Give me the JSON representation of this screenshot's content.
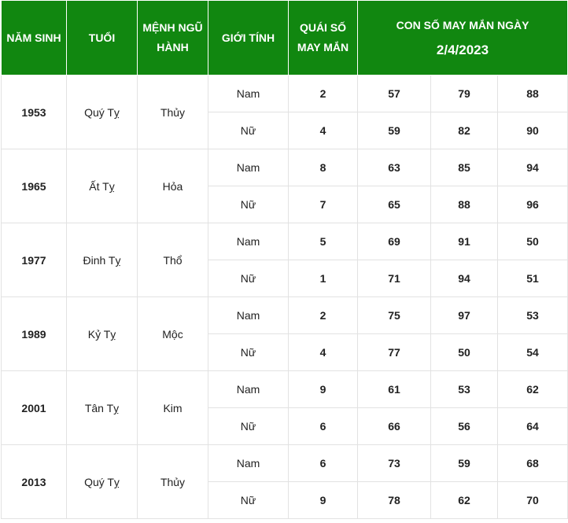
{
  "header": {
    "nam_sinh": "NĂM SINH",
    "tuoi": "TUỔI",
    "menh_line1": "MỆNH NGŨ",
    "menh_line2": "HÀNH",
    "gioi_tinh": "GIỚI TÍNH",
    "quai_line1": "QUÁI SỐ",
    "quai_line2": "MAY MẮN",
    "con_so_line1": "CON SỐ MAY MẮN NGÀY",
    "con_so_date": "2/4/2023"
  },
  "rows": [
    {
      "year": "1953",
      "tuoi": "Quý Tỵ",
      "menh": "Thủy",
      "entries": [
        {
          "gender": "Nam",
          "quai": "2",
          "numbers": [
            "57",
            "79",
            "88"
          ]
        },
        {
          "gender": "Nữ",
          "quai": "4",
          "numbers": [
            "59",
            "82",
            "90"
          ]
        }
      ]
    },
    {
      "year": "1965",
      "tuoi": "Ất Tỵ",
      "menh": "Hỏa",
      "entries": [
        {
          "gender": "Nam",
          "quai": "8",
          "numbers": [
            "63",
            "85",
            "94"
          ]
        },
        {
          "gender": "Nữ",
          "quai": "7",
          "numbers": [
            "65",
            "88",
            "96"
          ]
        }
      ]
    },
    {
      "year": "1977",
      "tuoi": "Đinh Tỵ",
      "menh": "Thổ",
      "entries": [
        {
          "gender": "Nam",
          "quai": "5",
          "numbers": [
            "69",
            "91",
            "50"
          ]
        },
        {
          "gender": "Nữ",
          "quai": "1",
          "numbers": [
            "71",
            "94",
            "51"
          ]
        }
      ]
    },
    {
      "year": "1989",
      "tuoi": "Kỷ Tỵ",
      "menh": "Mộc",
      "entries": [
        {
          "gender": "Nam",
          "quai": "2",
          "numbers": [
            "75",
            "97",
            "53"
          ]
        },
        {
          "gender": "Nữ",
          "quai": "4",
          "numbers": [
            "77",
            "50",
            "54"
          ]
        }
      ]
    },
    {
      "year": "2001",
      "tuoi": "Tân Tỵ",
      "menh": "Kim",
      "entries": [
        {
          "gender": "Nam",
          "quai": "9",
          "numbers": [
            "61",
            "53",
            "62"
          ]
        },
        {
          "gender": "Nữ",
          "quai": "6",
          "numbers": [
            "66",
            "56",
            "64"
          ]
        }
      ]
    },
    {
      "year": "2013",
      "tuoi": "Quý Tỵ",
      "menh": "Thủy",
      "entries": [
        {
          "gender": "Nam",
          "quai": "6",
          "numbers": [
            "73",
            "59",
            "68"
          ]
        },
        {
          "gender": "Nữ",
          "quai": "9",
          "numbers": [
            "78",
            "62",
            "70"
          ]
        }
      ]
    }
  ],
  "colors": {
    "header_bg": "#118710",
    "header_text": "#ffffff",
    "lucky_number": "#e8131b",
    "border": "#e2e2e2"
  }
}
